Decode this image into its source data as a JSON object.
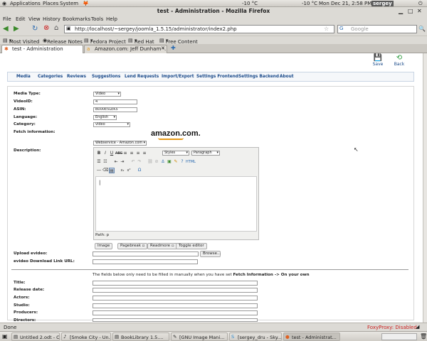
{
  "panel": {
    "applications": "Applications",
    "places": "Places",
    "system": "System",
    "weather": "-10 °C",
    "clock": "Mon Dec 21,  2:58 PM",
    "user": "sergey"
  },
  "window": {
    "title": "test - Administration - Mozilla Firefox"
  },
  "menu": [
    "File",
    "Edit",
    "View",
    "History",
    "Bookmarks",
    "Tools",
    "Help"
  ],
  "url": "http://localhost/~sergey/joomla_1.5.15/administrator/index2.php",
  "search_placeholder": "Google",
  "bookmarks": [
    "Most Visited",
    "Release Notes",
    "Fedora Project",
    "Red Hat",
    "Free Content"
  ],
  "tabs": [
    "test - Administration",
    "Amazon.com: Jeff Dunham -..."
  ],
  "toolbar": {
    "save": "Save",
    "back": "Back"
  },
  "nav": [
    "Media",
    "Categories",
    "Reviews",
    "Suggestions",
    "Lend Requests",
    "Import/Export",
    "Settings Frontend",
    "Settings Backend",
    "About"
  ],
  "form": {
    "media_type_label": "Media Type:",
    "media_type_value": "Video",
    "videoid_label": "VideoID:",
    "videoid_value": "4",
    "asin_label": "ASIN:",
    "asin_value": "B000E5LEK5",
    "language_label": "Language:",
    "language_value": "English",
    "category_label": "Category:",
    "category_value": "video",
    "fetch_label": "Fetch information:",
    "amazon_logo": "amazon.com.",
    "fetch_select": "Webservice - Amazon.com",
    "description_label": "Description:",
    "styles": "Styles",
    "paragraph": "Paragraph",
    "path": "Path: p",
    "btn_image": "Image",
    "btn_pagebreak": "Pagebreak",
    "btn_readmore": "Readmore",
    "btn_toggle": "Toggle editor",
    "upload_label": "Upload evideo:",
    "browse": "Browse...",
    "download_label": "evideo Download Link URL:",
    "note_prefix": "The fields below only need to be filled in manually when you have set ",
    "note_bold": "Fetch Information -> On your own",
    "title_label": "Title:",
    "release_label": "Release date:",
    "actors_label": "Actors:",
    "studio_label": "Studio:",
    "producers_label": "Producers:",
    "directors_label": "Directors:"
  },
  "status": {
    "left": "Done",
    "foxyproxy": "FoxyProxy: Disabled"
  },
  "taskbar": [
    "Untitled 2.odt - O...",
    "[Smoke City - Un...",
    "BookLibrary 1.5....",
    "[GNU Image Mani...",
    "[sergey_dru - Sky...",
    "test - Administrat..."
  ],
  "colors": {
    "link": "#1a4a8a",
    "foxyproxy": "#cc2222"
  }
}
